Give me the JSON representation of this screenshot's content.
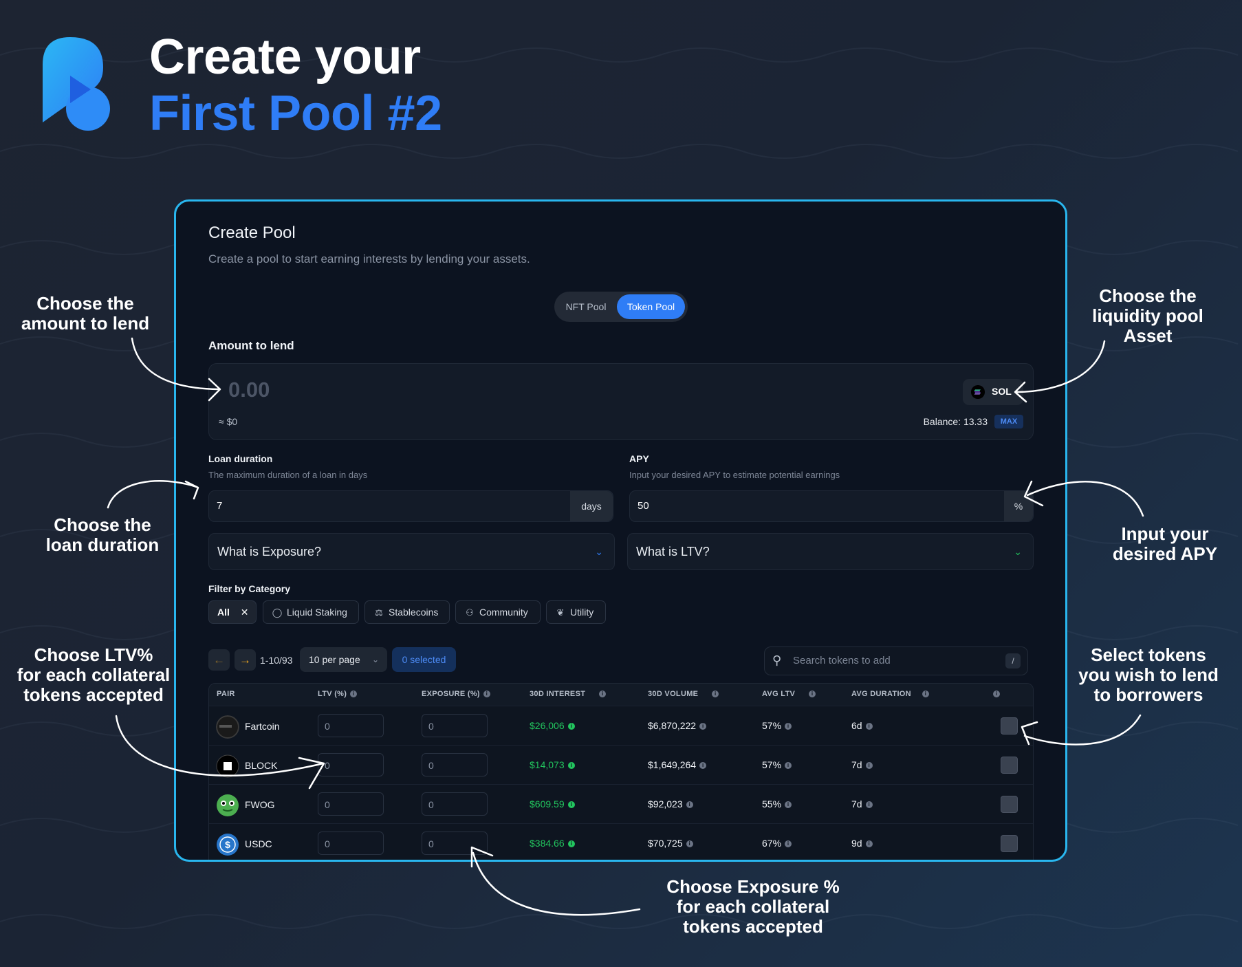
{
  "header": {
    "title_line1": "Create your",
    "title_line2": "First Pool #2"
  },
  "colors": {
    "accent": "#2f7df6",
    "card_border": "#29b6ee",
    "green": "#22c55e",
    "pager_arrow": "#f0a820"
  },
  "annotations": {
    "amount": [
      "Choose the",
      "amount to lend"
    ],
    "asset": [
      "Choose the",
      "liquidity pool",
      "Asset"
    ],
    "duration": [
      "Choose the",
      "loan duration"
    ],
    "apy": [
      "Input your",
      "desired APY"
    ],
    "ltv": [
      "Choose LTV%",
      "for each collateral",
      "tokens accepted"
    ],
    "select": [
      "Select tokens",
      "you wish to lend",
      "to borrowers"
    ],
    "exposure": [
      "Choose Exposure %",
      "for each collateral",
      "tokens accepted"
    ]
  },
  "card": {
    "title": "Create Pool",
    "subtitle": "Create a pool to start earning interests by lending your assets.",
    "toggle": {
      "nft": "NFT Pool",
      "token": "Token Pool",
      "active": "token"
    },
    "amount": {
      "label": "Amount to lend",
      "value": "0.00",
      "usd": "≈ $0",
      "asset": "SOL",
      "balance": "Balance: 13.33",
      "max": "MAX"
    },
    "loan_duration": {
      "label": "Loan duration",
      "help": "The maximum duration of a loan in days",
      "value": "7",
      "suffix": "days"
    },
    "apy": {
      "label": "APY",
      "help": "Input your desired APY to estimate potential earnings",
      "value": "50",
      "suffix": "%"
    },
    "accordions": {
      "exposure": "What is Exposure?",
      "ltv": "What is LTV?"
    },
    "filter": {
      "label": "Filter by Category",
      "chips": [
        {
          "label": "All",
          "icon": "close-icon",
          "active": true
        },
        {
          "label": "Liquid Staking",
          "icon": "coin-icon"
        },
        {
          "label": "Stablecoins",
          "icon": "scale-icon"
        },
        {
          "label": "Community",
          "icon": "people-icon"
        },
        {
          "label": "Utility",
          "icon": "wrench-icon"
        }
      ]
    },
    "pagination": {
      "range": "1-10/93",
      "per_page": "10 per page",
      "selected": "0 selected"
    },
    "search": {
      "placeholder": "Search tokens to add",
      "shortcut": "/"
    },
    "table": {
      "columns": [
        "PAIR",
        "LTV (%)",
        "EXPOSURE (%)",
        "30D INTEREST",
        "30D VOLUME",
        "AVG LTV",
        "AVG DURATION"
      ],
      "rows": [
        {
          "pair": "Fartcoin",
          "ltv": "0",
          "exposure": "0",
          "interest": "$26,006",
          "volume": "$6,870,222",
          "avg_ltv": "57%",
          "avg_duration": "6d"
        },
        {
          "pair": "BLOCK",
          "ltv": "0",
          "exposure": "0",
          "interest": "$14,073",
          "volume": "$1,649,264",
          "avg_ltv": "57%",
          "avg_duration": "7d"
        },
        {
          "pair": "FWOG",
          "ltv": "0",
          "exposure": "0",
          "interest": "$609.59",
          "volume": "$92,023",
          "avg_ltv": "55%",
          "avg_duration": "7d"
        },
        {
          "pair": "USDC",
          "ltv": "0",
          "exposure": "0",
          "interest": "$384.66",
          "volume": "$70,725",
          "avg_ltv": "67%",
          "avg_duration": "9d"
        }
      ]
    }
  }
}
